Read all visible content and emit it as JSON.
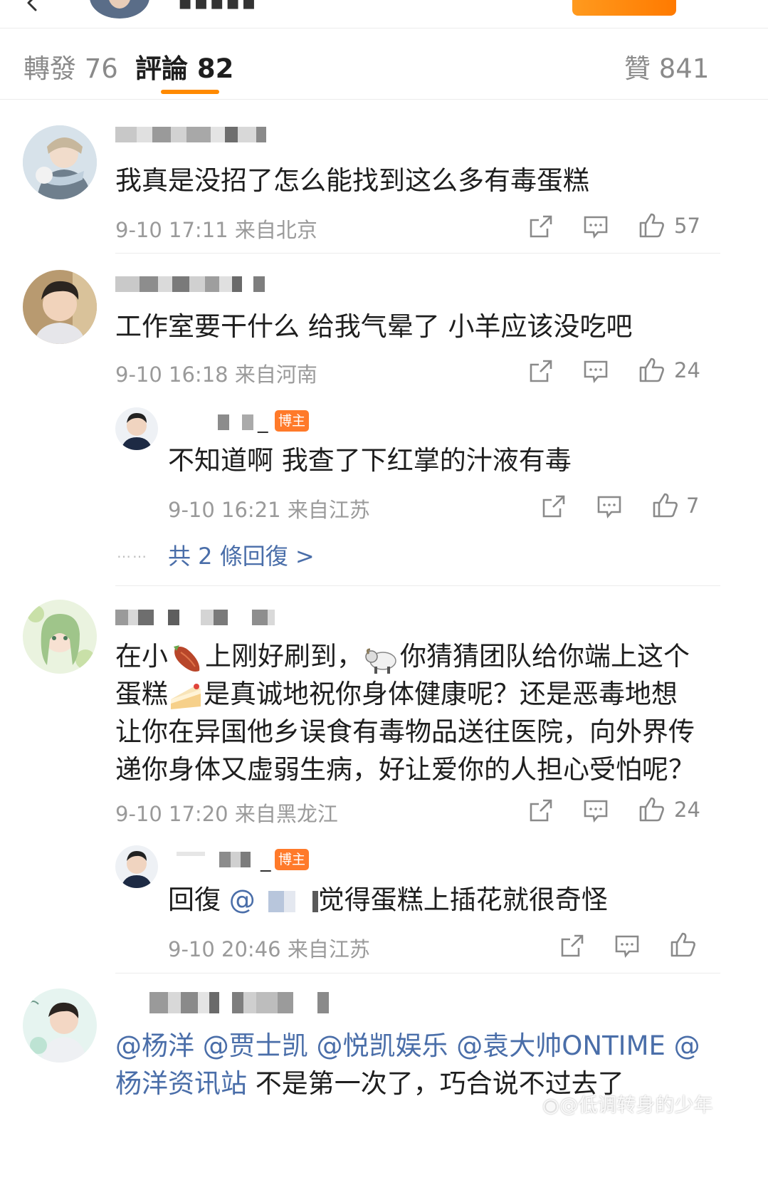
{
  "tabs": {
    "reposts": "轉發 76",
    "comments": "評論 82",
    "likes": "贊 841"
  },
  "comments": [
    {
      "text": "我真是没招了怎么能找到这么多有毒蛋糕",
      "time": "9-10 17:11",
      "location": "来自北京",
      "likes": "57"
    },
    {
      "text": "工作室要干什么 给我气晕了 小羊应该没吃吧",
      "time": "9-10 16:18",
      "location": "来自河南",
      "likes": "24",
      "reply": {
        "name_tail": "_",
        "badge": "博主",
        "text": "不知道啊 我查了下红掌的汁液有毒",
        "time": "9-10 16:21",
        "location": "来自江苏",
        "likes": "7"
      },
      "more_replies": "共 2 條回復 >"
    },
    {
      "lines": [
        {
          "a": "在小",
          "b": "上刚好刷到，",
          "c": "你猜猜团队给你端上这个"
        },
        {
          "a": "蛋糕",
          "b": "是真诚地祝你身体健康呢？还是恶毒地想"
        },
        {
          "a": "让你在异国他乡误食有毒物品送往医院，向外界传"
        },
        {
          "a": "递你身体又虚弱生病，好让爱你的人担心受怕呢？"
        }
      ],
      "time": "9-10 17:20",
      "location": "来自黑龙江",
      "likes": "24",
      "reply": {
        "name_tail": "_",
        "badge": "博主",
        "reply_prefix": "回復",
        "at": "@",
        "text": "觉得蛋糕上插花就很奇怪",
        "time": "9-10 20:46",
        "location": "来自江苏"
      }
    },
    {
      "mentions_line1": "@杨洋 @贾士凯 @悦凯娱乐 @袁大帅ONTIME @",
      "mentions_line2": "杨洋资讯站",
      "text": " 不是第一次了，巧合说不过去了"
    }
  ],
  "watermark": "@低调转身的少年",
  "icons": [
    "back-icon",
    "repost-icon",
    "comment-icon",
    "like-icon"
  ],
  "colors": {
    "accent": "#ff8a00",
    "link": "#4a6ea9",
    "badge": "#ff7a2a"
  }
}
